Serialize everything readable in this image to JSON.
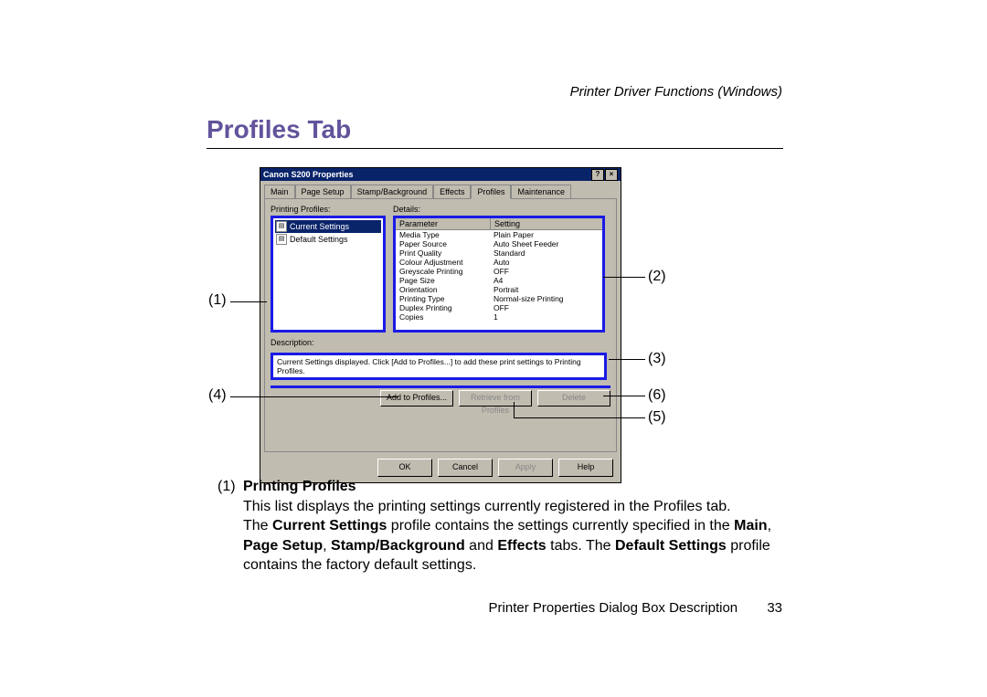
{
  "header": {
    "right": "Printer Driver Functions (Windows)"
  },
  "section_title": "Profiles Tab",
  "dialog": {
    "title": "Canon S200 Properties",
    "help_btn": "?",
    "close_btn": "×",
    "tabs": [
      "Main",
      "Page Setup",
      "Stamp/Background",
      "Effects",
      "Profiles",
      "Maintenance"
    ],
    "active_tab_index": 4,
    "profiles_label": "Printing Profiles:",
    "details_label": "Details:",
    "profiles_list": [
      {
        "label": "Current Settings",
        "selected": true
      },
      {
        "label": "Default Settings",
        "selected": false
      }
    ],
    "details_headers": [
      "Parameter",
      "Setting"
    ],
    "details_rows": [
      [
        "Media Type",
        "Plain Paper"
      ],
      [
        "Paper Source",
        "Auto Sheet Feeder"
      ],
      [
        "Print Quality",
        "Standard"
      ],
      [
        "Colour Adjustment",
        "Auto"
      ],
      [
        "Greyscale Printing",
        "OFF"
      ],
      [
        "Page Size",
        "A4"
      ],
      [
        "Orientation",
        "Portrait"
      ],
      [
        "Printing Type",
        "Normal-size Printing"
      ],
      [
        "Duplex Printing",
        "OFF"
      ],
      [
        "Copies",
        "1"
      ]
    ],
    "description_label": "Description:",
    "description_text": "Current Settings displayed. Click [Add to Profiles...] to add these print settings to Printing Profiles.",
    "profile_buttons": {
      "add": "Add to Profiles...",
      "retrieve": "Retrieve from Profiles",
      "delete": "Delete"
    },
    "dialog_buttons": {
      "ok": "OK",
      "cancel": "Cancel",
      "apply": "Apply",
      "help": "Help"
    }
  },
  "callouts": {
    "c1": "(1)",
    "c2": "(2)",
    "c3": "(3)",
    "c4": "(4)",
    "c5": "(5)",
    "c6": "(6)"
  },
  "body": {
    "num": "(1)",
    "title": "Printing Profiles",
    "p1": "This list displays the printing settings currently registered in the Profiles tab.",
    "p2a": "The ",
    "p2b": "Current Settings",
    "p2c": " profile contains the settings currently specified in the ",
    "p2d": "Main",
    "p2e": ", ",
    "p3a": "Page Setup",
    "p3b": ", ",
    "p3c": "Stamp/Background",
    "p3d": " and ",
    "p3e": "Effects",
    "p3f": " tabs. The ",
    "p3g": "Default Settings",
    "p3h": " profile",
    "p4": "contains the factory default settings."
  },
  "footer": {
    "text": "Printer Properties Dialog Box Description",
    "page": "33"
  }
}
